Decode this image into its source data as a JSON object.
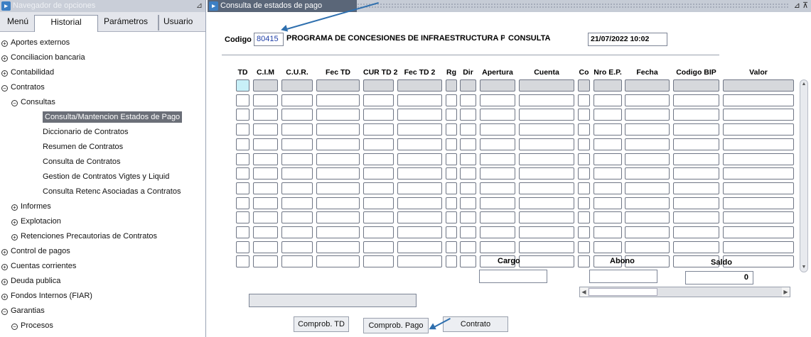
{
  "navigator": {
    "title": "Navegador de opciones",
    "tabs": [
      "Menú",
      "Historial",
      "Parámetros",
      "Usuario"
    ],
    "tree": [
      {
        "label": "Aportes externos",
        "level": 0,
        "state": "collapsed"
      },
      {
        "label": "Conciliacion bancaria",
        "level": 0,
        "state": "collapsed"
      },
      {
        "label": "Contabilidad",
        "level": 0,
        "state": "collapsed"
      },
      {
        "label": "Contratos",
        "level": 0,
        "state": "expanded"
      },
      {
        "label": "Consultas",
        "level": 1,
        "state": "expanded"
      },
      {
        "label": "Consulta/Mantencion Estados de Pago",
        "level": 2,
        "state": "leaf",
        "selected": true
      },
      {
        "label": "Diccionario de Contratos",
        "level": 2,
        "state": "leaf"
      },
      {
        "label": "Resumen de Contratos",
        "level": 2,
        "state": "leaf"
      },
      {
        "label": "Consulta de Contratos",
        "level": 2,
        "state": "leaf"
      },
      {
        "label": "Gestion de Contratos Vigtes y Liquid",
        "level": 2,
        "state": "leaf"
      },
      {
        "label": "Consulta Retenc Asociadas a Contratos",
        "level": 2,
        "state": "leaf"
      },
      {
        "label": "Informes",
        "level": 1,
        "state": "collapsed"
      },
      {
        "label": "Explotacion",
        "level": 1,
        "state": "collapsed"
      },
      {
        "label": "Retenciones Precautorias de Contratos",
        "level": 1,
        "state": "collapsed"
      },
      {
        "label": "Control de pagos",
        "level": 0,
        "state": "collapsed"
      },
      {
        "label": "Cuentas corrientes",
        "level": 0,
        "state": "collapsed"
      },
      {
        "label": "Deuda publica",
        "level": 0,
        "state": "collapsed"
      },
      {
        "label": "Fondos Internos (FIAR)",
        "level": 0,
        "state": "collapsed"
      },
      {
        "label": "Garantias",
        "level": 0,
        "state": "expanded"
      },
      {
        "label": "Procesos",
        "level": 1,
        "state": "expanded"
      }
    ]
  },
  "form": {
    "title": "Consulta de estados de pago",
    "codigo_label": "Codigo",
    "codigo_value": "80415",
    "program_name": "PROGRAMA DE CONCESIONES DE INFRAESTRUCTURA PENITENCI/",
    "mode": "CONSULTA",
    "datetime": "21/07/2022 10:02",
    "columns": [
      "TD",
      "C.I.M",
      "C.U.R.",
      "Fec TD",
      "CUR TD 2",
      "Fec TD 2",
      "Rg",
      "Dir",
      "Apertura",
      "Cuenta",
      "Co",
      "Nro E.P.",
      "Fecha",
      "Codigo BIP",
      "Valor"
    ],
    "row_count": 13,
    "totals": {
      "cargo_label": "Cargo",
      "cargo_value": "",
      "abono_label": "Abono",
      "abono_value": "",
      "saldo_label": "Saldo",
      "saldo_value": "0"
    },
    "buttons": {
      "comprob_td": "Comprob. TD",
      "comprob_pago": "Comprob. Pago",
      "contrato": "Contrato"
    }
  },
  "colors": {
    "form_titlebar": "#5a6678",
    "selected_tree_item": "#6b6f78",
    "arrow": "#2e6fae",
    "codigo_text": "#1f3fa8"
  }
}
